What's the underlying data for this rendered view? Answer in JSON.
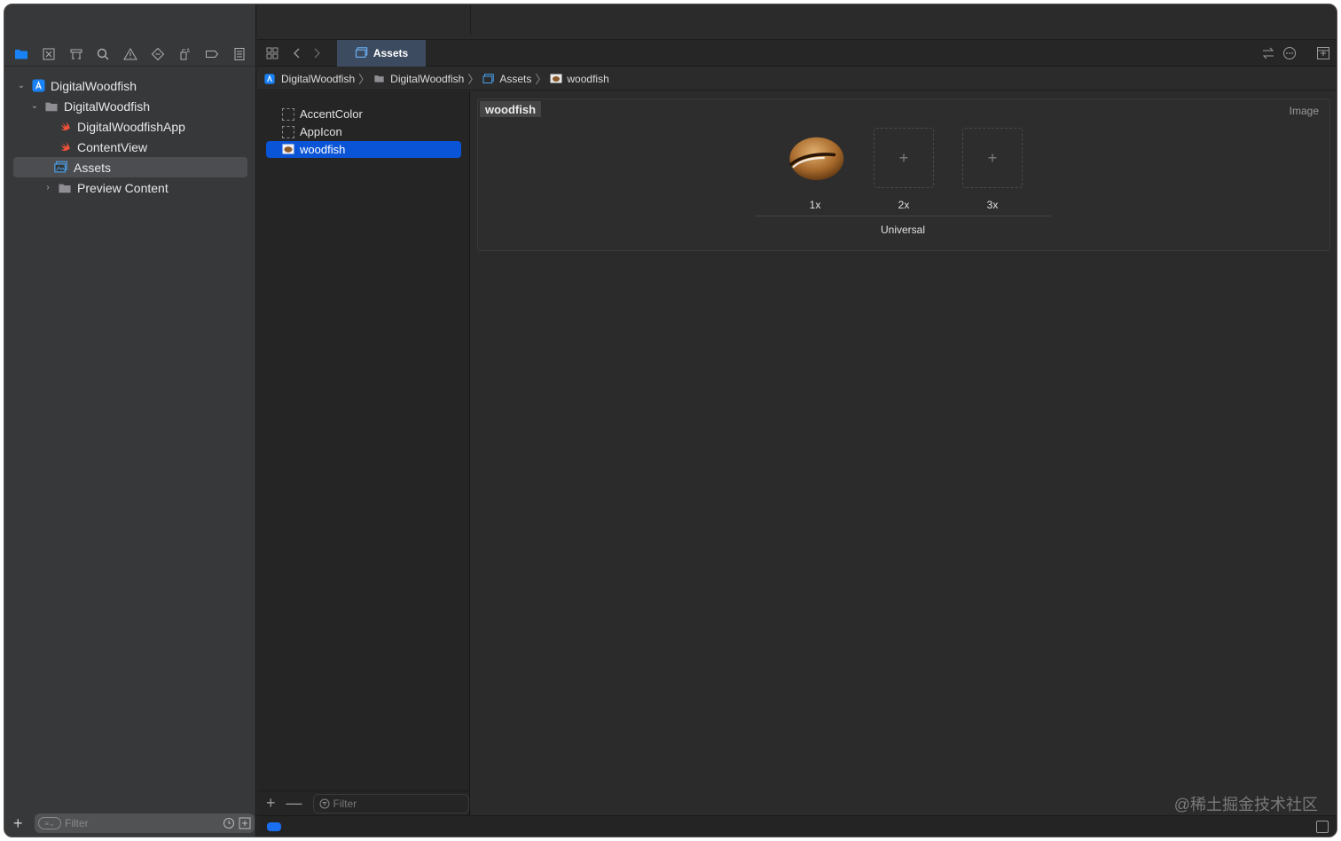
{
  "colors": {
    "accent": "#0a54d7",
    "swift_orange": "#f05138",
    "folder_grey": "#8e8e93",
    "asset_blue": "#4aa3f0"
  },
  "navigator": {
    "toolbar_icons": [
      "folder-icon",
      "source-control-icon",
      "symbol-icon",
      "search-icon",
      "issue-warning-icon",
      "test-diamond-icon",
      "debug-spray-icon",
      "breakpoint-icon",
      "report-icon"
    ],
    "tree": [
      {
        "label": "DigitalWoodfish",
        "icon": "xcode-project-icon",
        "level": 0,
        "expanded": true
      },
      {
        "label": "DigitalWoodfish",
        "icon": "folder-icon",
        "level": 1,
        "expanded": true
      },
      {
        "label": "DigitalWoodfishApp",
        "icon": "swift-file-icon",
        "level": 2
      },
      {
        "label": "ContentView",
        "icon": "swift-file-icon",
        "level": 2
      },
      {
        "label": "Assets",
        "icon": "asset-catalog-icon",
        "level": 2,
        "selected": true
      },
      {
        "label": "Preview Content",
        "icon": "folder-icon",
        "level": 2,
        "expanded": false
      }
    ],
    "filter_placeholder": "Filter"
  },
  "tabs": {
    "active": "Assets"
  },
  "breadcrumb": [
    "DigitalWoodfish",
    "DigitalWoodfish",
    "Assets",
    "woodfish"
  ],
  "assets": {
    "items": [
      {
        "label": "AccentColor",
        "icon": "color-set-icon"
      },
      {
        "label": "AppIcon",
        "icon": "app-icon-set-icon"
      },
      {
        "label": "woodfish",
        "icon": "image-set-icon",
        "selected": true
      }
    ],
    "filter_placeholder": "Filter"
  },
  "detail": {
    "name": "woodfish",
    "type": "Image",
    "slots": [
      "1x",
      "2x",
      "3x"
    ],
    "group": "Universal"
  },
  "watermark": "@稀土掘金技术社区"
}
